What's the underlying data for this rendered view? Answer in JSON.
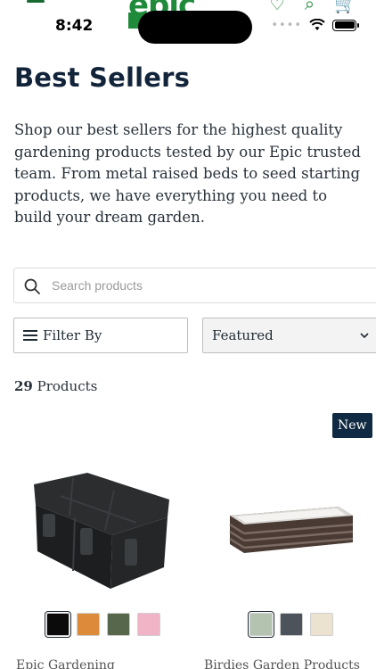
{
  "status_bar": {
    "time": "8:42"
  },
  "brand": {
    "logo_text": "epic"
  },
  "page": {
    "title": "Best Sellers",
    "intro": "Shop our best sellers for the highest quality gardening products tested by our Epic trusted team. From metal raised beds to seed starting products, we have everything you need to build your dream garden."
  },
  "search": {
    "placeholder": "Search products",
    "value": ""
  },
  "filters": {
    "filter_label": "Filter By",
    "sort_label": "Featured"
  },
  "results": {
    "count": "29",
    "count_suffix": " Products"
  },
  "products": [
    {
      "vendor": "Epic Gardening",
      "badge": "",
      "swatches": [
        "#0b0b0b",
        "#dd8a3a",
        "#56674b",
        "#f1b4c6"
      ]
    },
    {
      "vendor": "Birdies Garden Products",
      "badge": "New",
      "swatches": [
        "#b4c3b0",
        "#4d535a",
        "#ebe3cf"
      ]
    }
  ],
  "colors": {
    "brand_green": "#1e8a3a",
    "navy": "#12243a",
    "badge_bg": "#0f2a42"
  }
}
